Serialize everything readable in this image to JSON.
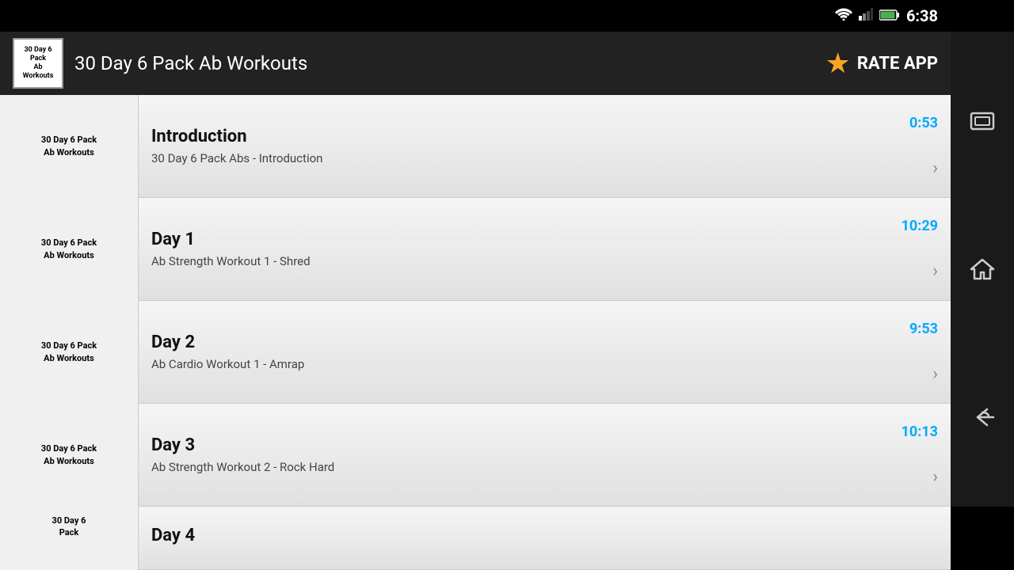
{
  "status_bar": {
    "time": "6:38"
  },
  "header": {
    "app_icon_text": "30 Day 6 Pack\nAb Workouts",
    "app_title": "30 Day 6 Pack Ab Workouts",
    "rate_app_label": "RATE APP",
    "star_icon": "★"
  },
  "workouts": [
    {
      "thumb_text": "30 Day 6 Pack\nAb Workouts",
      "title": "Introduction",
      "subtitle": "30 Day 6 Pack Abs - Introduction",
      "duration": "0:53"
    },
    {
      "thumb_text": "30 Day 6 Pack\nAb Workouts",
      "title": "Day 1",
      "subtitle": "Ab Strength Workout 1 - Shred",
      "duration": "10:29"
    },
    {
      "thumb_text": "30 Day 6 Pack\nAb Workouts",
      "title": "Day 2",
      "subtitle": "Ab Cardio Workout 1 - Amrap",
      "duration": "9:53"
    },
    {
      "thumb_text": "30 Day 6 Pack\nAb Workouts",
      "title": "Day 3",
      "subtitle": "Ab Strength Workout 2 - Rock Hard",
      "duration": "10:13"
    },
    {
      "thumb_text": "30 Day 6\nPack",
      "title": "Day 4",
      "subtitle": "",
      "duration": ""
    }
  ]
}
